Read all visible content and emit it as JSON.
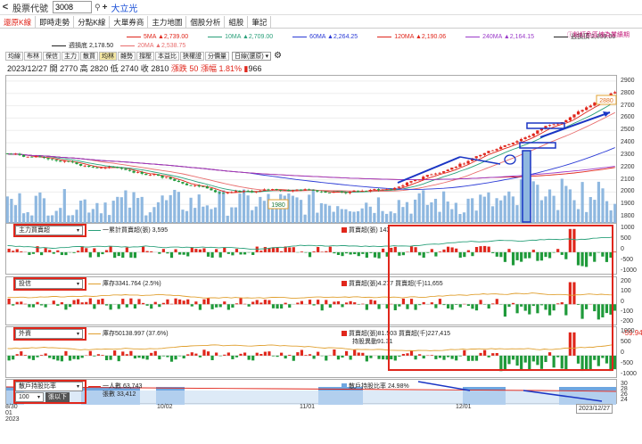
{
  "topbar": {
    "back_glyph": "<",
    "label": "股票代號",
    "code": "3008",
    "search_icon": "search-icon",
    "plus_glyph": "+",
    "stock_name": "大立光"
  },
  "tabs": [
    {
      "label": "還原K線",
      "active": true
    },
    {
      "label": "即時走勢",
      "active": false
    },
    {
      "label": "分點K線",
      "active": false
    },
    {
      "label": "大單券商",
      "active": false
    },
    {
      "label": "主力地圖",
      "active": false
    },
    {
      "label": "個股分析",
      "active": false
    },
    {
      "label": "組股",
      "active": false
    },
    {
      "label": "筆記",
      "active": false
    }
  ],
  "ma": [
    {
      "text": "5MA ▲2,739.00",
      "color": "#e0261b"
    },
    {
      "text": "10MA ▲2,709.00",
      "color": "#2aa07a"
    },
    {
      "text": "60MA ▲2,264.25",
      "color": "#2b3bd6"
    },
    {
      "text": "120MA ▲2,190.06",
      "color": "#e0261b"
    },
    {
      "text": "240MA ▲2,164.15",
      "color": "#9b3bc9"
    },
    {
      "text": "週損頂 2,899.00",
      "color": "#222222"
    }
  ],
  "ma2": [
    {
      "text": "週損底 2,178.50",
      "color": "#222222"
    },
    {
      "text": "20MA ▲2,538.75",
      "color": "#e86d6d"
    }
  ],
  "note": "ⓘ粉紅色區塊為業績期",
  "indicator_tabs": [
    "均線",
    "布林",
    "保信",
    "主力",
    "散買",
    "均林",
    "雜勢",
    "撐壓",
    "本益比",
    "狹權證",
    "分價量"
  ],
  "indicator_selected": 5,
  "period_select": "日線(還原)",
  "price_info": {
    "date": "2023/12/27",
    "open_label": "開",
    "open": "2770",
    "high_label": "高",
    "high": "2820",
    "low_label": "低",
    "low": "2740",
    "close_label": "收",
    "close": "2810",
    "chg_label": "漲跌",
    "chg": "50",
    "pct_label": "漲幅",
    "pct": "1.81%",
    "vol": "966"
  },
  "price_axis": [
    "2900",
    "2800",
    "2700",
    "2600",
    "2500",
    "2400",
    "2300",
    "2200",
    "2100",
    "2000",
    "1900",
    "1800"
  ],
  "price_callouts": {
    "high": "2880",
    "low": "1980"
  },
  "panels": [
    {
      "select": "主力買賣超",
      "left_hdr": "一累計買賣超(張) 3,595",
      "left_color": "#2aa07a",
      "right_hdr": "買賣超(張) 143",
      "right_color": "#e0261b",
      "axis": [
        "1000",
        "500",
        "0",
        "-500",
        "-1000"
      ]
    },
    {
      "select": "投信",
      "left_hdr": "庫存3341.764 (2.5%)",
      "left_color": "#e0a030",
      "right_hdr": "買賣超(張)4.277 買賣超(千)11,655",
      "right_color": "#e0261b",
      "axis": [
        "200",
        "100",
        "0",
        "-100",
        "-200"
      ],
      "side_value": "-59.94"
    },
    {
      "select": "外資",
      "left_hdr": "庫存50138.997 (37.6%)",
      "left_color": "#e0a030",
      "right_hdr": "買賣超(張)81.503 買賣超(千)227,415",
      "right_hdr2": "持股異動91.31",
      "right_color": "#e0261b",
      "axis": [
        "1000",
        "500",
        "0",
        "-500",
        "-1000"
      ]
    },
    {
      "select": "散戶持股比率",
      "select2": "100",
      "select2_btn": "張以下",
      "left_hdr": "一人數 63,743",
      "left_hdr2": "張數 33,412",
      "left_color": "#e0261b",
      "right_hdr": "散戶持股比率 24.98%",
      "right_color": "#6ea6e0",
      "axis": [
        "30",
        "28",
        "26",
        "24"
      ]
    }
  ],
  "xaxis": [
    "8/30\n01\n2023",
    "10/02",
    "11/01",
    "12/01",
    "2023/12/27"
  ]
}
